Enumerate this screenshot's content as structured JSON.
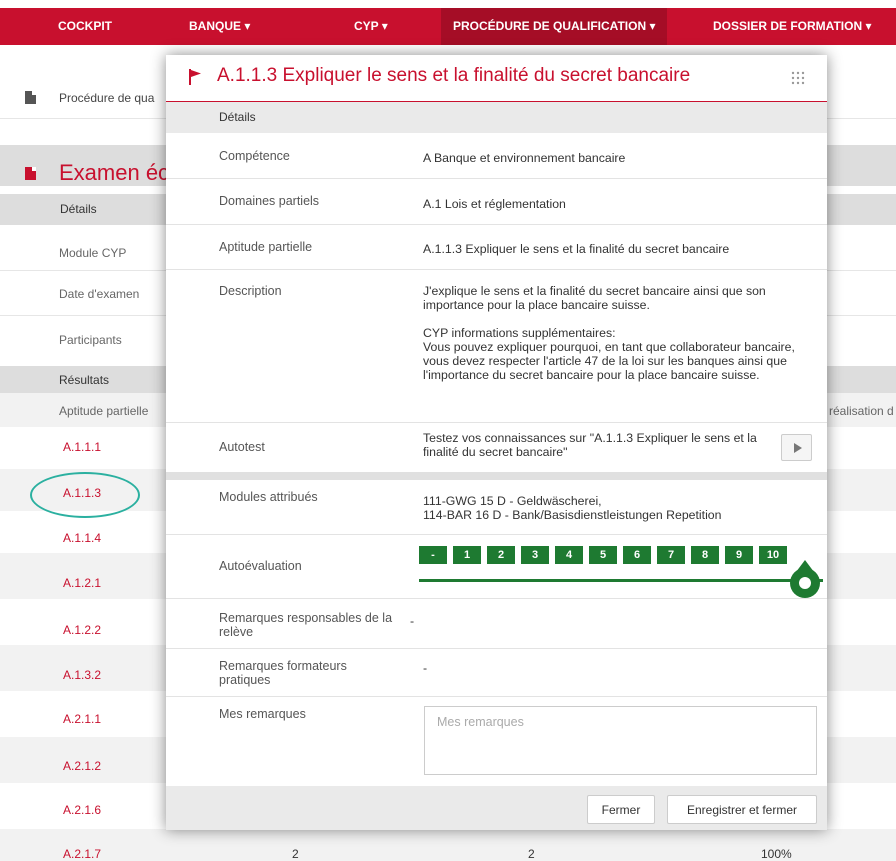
{
  "nav": {
    "items": [
      {
        "label": "COCKPIT"
      },
      {
        "label": "BANQUE ▾"
      },
      {
        "label": "CYP ▾"
      },
      {
        "label": "PROCÉDURE DE QUALIFICATION ▾"
      },
      {
        "label": "DOSSIER DE FORMATION ▾"
      }
    ]
  },
  "background": {
    "breadcrumb": "Procédure de qua",
    "section_title": "Examen écr",
    "details_label": "Détails",
    "rows": [
      "Module CYP",
      "Date d'examen",
      "Participants"
    ],
    "results_label": "Résultats",
    "col_aptitude": "Aptitude partielle",
    "col_realisation": "réalisation d",
    "result_links": [
      "A.1.1.1",
      "A.1.1.3",
      "A.1.1.4",
      "A.1.2.1",
      "A.1.2.2",
      "A.1.3.2",
      "A.2.1.1",
      "A.2.1.2",
      "A.2.1.6",
      "A.2.1.7"
    ],
    "last_row_values": [
      "2",
      "2",
      "100%"
    ]
  },
  "modal": {
    "title": "A.1.1.3 Expliquer le sens et la finalité du secret bancaire",
    "details_label": "Détails",
    "fields": {
      "competence": {
        "label": "Compétence",
        "value": "A Banque et environnement bancaire"
      },
      "domaines": {
        "label": "Domaines partiels",
        "value": "A.1 Lois et réglementation"
      },
      "aptitude": {
        "label": "Aptitude partielle",
        "value": "A.1.1.3 Expliquer le sens et la finalité du secret bancaire"
      },
      "description": {
        "label": "Description",
        "para1": "J'explique le sens et la finalité du secret bancaire ainsi que son importance pour la place bancaire suisse.",
        "para2_title": "CYP informations supplémentaires:",
        "para2": "Vous pouvez expliquer pourquoi, en tant que collaborateur bancaire, vous devez respecter l'article 47 de la loi sur les banques ainsi que l'importance du secret bancaire pour la place bancaire suisse."
      },
      "autotest": {
        "label": "Autotest",
        "value": "Testez vos connaissances sur \"A.1.1.3 Expliquer le sens et la finalité du secret bancaire\""
      },
      "modules": {
        "label": "Modules attribués",
        "line1": "111-GWG 15 D - Geldwäscherei,",
        "line2": "114-BAR 16 D - Bank/Basisdienstleistungen Repetition"
      },
      "autoevaluation": {
        "label": "Autoévaluation",
        "scale": [
          "-",
          "1",
          "2",
          "3",
          "4",
          "5",
          "6",
          "7",
          "8",
          "9",
          "10"
        ],
        "selected": "10"
      },
      "remarques_releve": {
        "label": "Remarques responsables de la relève",
        "value": "-"
      },
      "remarques_formateurs": {
        "label": "Remarques formateurs pratiques",
        "value": "-"
      },
      "mes_remarques": {
        "label": "Mes remarques",
        "placeholder": "Mes remarques"
      }
    },
    "buttons": {
      "close": "Fermer",
      "save_close": "Enregistrer et fermer"
    }
  },
  "colors": {
    "brand_red": "#c8102e",
    "scale_green": "#1e7a31",
    "highlight_teal": "#2bb0a0"
  }
}
